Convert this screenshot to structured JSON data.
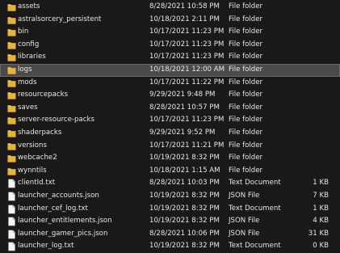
{
  "colors": {
    "background": "#191919",
    "selected_row": "#4a4a4a",
    "folder_icon": "#f2c64a",
    "file_icon": "#f4f4f4"
  },
  "icons": {
    "folder": "folder-icon",
    "file": "document-icon"
  },
  "selected_row_index": 5,
  "rows": [
    {
      "name": "assets",
      "date": "8/28/2021 10:58 PM",
      "type": "File folder",
      "size": "",
      "icon": "folder"
    },
    {
      "name": "astralsorcery_persistent",
      "date": "10/18/2021 2:11 PM",
      "type": "File folder",
      "size": "",
      "icon": "folder"
    },
    {
      "name": "bin",
      "date": "10/17/2021 11:23 PM",
      "type": "File folder",
      "size": "",
      "icon": "folder"
    },
    {
      "name": "config",
      "date": "10/17/2021 11:23 PM",
      "type": "File folder",
      "size": "",
      "icon": "folder"
    },
    {
      "name": "libraries",
      "date": "10/17/2021 11:23 PM",
      "type": "File folder",
      "size": "",
      "icon": "folder"
    },
    {
      "name": "logs",
      "date": "10/18/2021 12:00 AM",
      "type": "File folder",
      "size": "",
      "icon": "folder"
    },
    {
      "name": "mods",
      "date": "10/17/2021 11:22 PM",
      "type": "File folder",
      "size": "",
      "icon": "folder"
    },
    {
      "name": "resourcepacks",
      "date": "9/29/2021 9:48 PM",
      "type": "File folder",
      "size": "",
      "icon": "folder"
    },
    {
      "name": "saves",
      "date": "8/28/2021 10:57 PM",
      "type": "File folder",
      "size": "",
      "icon": "folder"
    },
    {
      "name": "server-resource-packs",
      "date": "10/17/2021 11:23 PM",
      "type": "File folder",
      "size": "",
      "icon": "folder"
    },
    {
      "name": "shaderpacks",
      "date": "9/29/2021 9:52 PM",
      "type": "File folder",
      "size": "",
      "icon": "folder"
    },
    {
      "name": "versions",
      "date": "10/17/2021 11:21 PM",
      "type": "File folder",
      "size": "",
      "icon": "folder"
    },
    {
      "name": "webcache2",
      "date": "10/19/2021 8:32 PM",
      "type": "File folder",
      "size": "",
      "icon": "folder"
    },
    {
      "name": "wynntils",
      "date": "10/18/2021 1:15 AM",
      "type": "File folder",
      "size": "",
      "icon": "folder"
    },
    {
      "name": "clientId.txt",
      "date": "8/28/2021 10:03 PM",
      "type": "Text Document",
      "size": "1 KB",
      "icon": "file"
    },
    {
      "name": "launcher_accounts.json",
      "date": "10/19/2021 8:32 PM",
      "type": "JSON File",
      "size": "7 KB",
      "icon": "file"
    },
    {
      "name": "launcher_cef_log.txt",
      "date": "10/19/2021 8:32 PM",
      "type": "Text Document",
      "size": "1 KB",
      "icon": "file"
    },
    {
      "name": "launcher_entitlements.json",
      "date": "10/19/2021 8:32 PM",
      "type": "JSON File",
      "size": "4 KB",
      "icon": "file"
    },
    {
      "name": "launcher_gamer_pics.json",
      "date": "8/28/2021 10:06 PM",
      "type": "JSON File",
      "size": "31 KB",
      "icon": "file"
    },
    {
      "name": "launcher_log.txt",
      "date": "10/19/2021 8:32 PM",
      "type": "Text Document",
      "size": "0 KB",
      "icon": "file"
    }
  ]
}
